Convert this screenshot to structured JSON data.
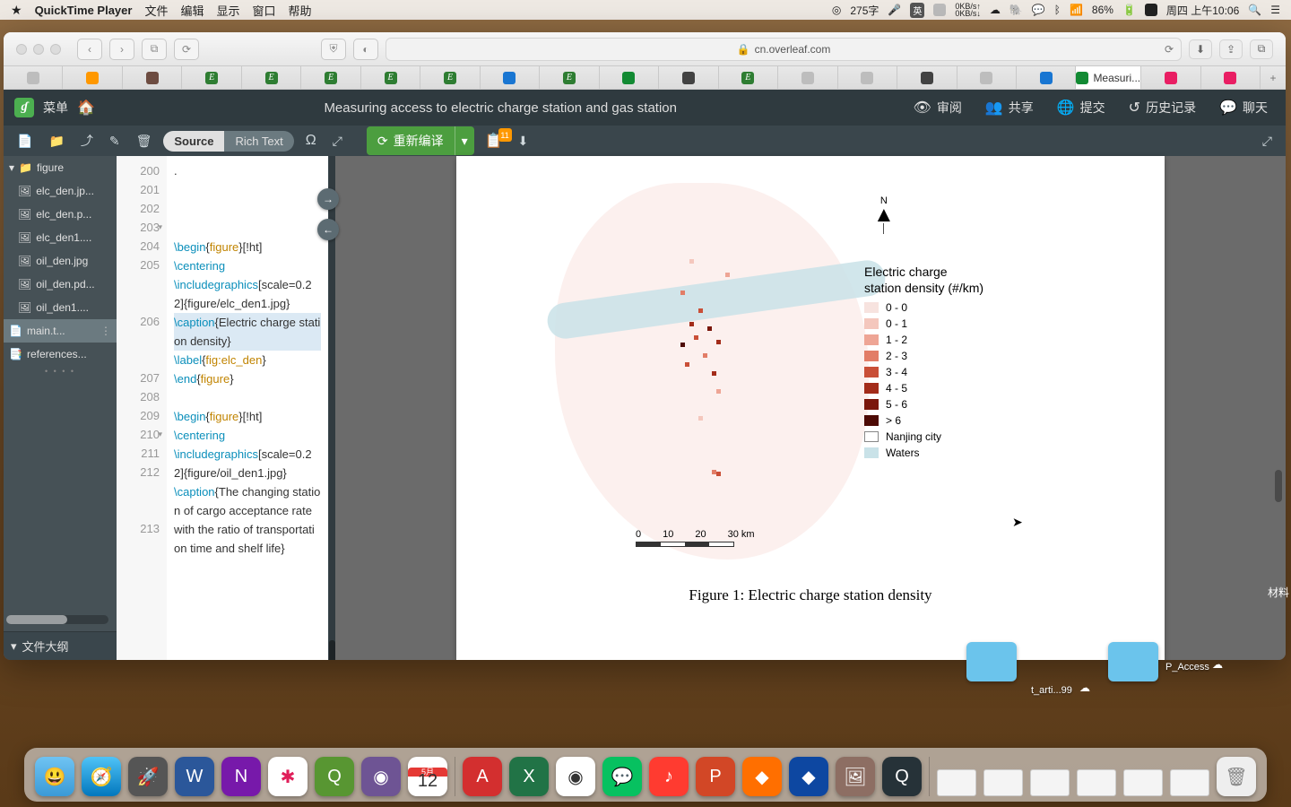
{
  "menubar": {
    "app_name": "QuickTime Player",
    "items": [
      "文件",
      "编辑",
      "显示",
      "窗口",
      "帮助"
    ],
    "right": {
      "zoom": "275字",
      "net_up": "0KB/s",
      "net_dn": "0KB/s",
      "battery": "86%",
      "clock": "周四 上午10:06"
    }
  },
  "safari": {
    "url": "cn.overleaf.com",
    "active_tab_label": "Measuri...",
    "new_tab_plus": "+"
  },
  "overleaf_top": {
    "menu_label": "菜单",
    "project_title": "Measuring access to electric charge station and gas station",
    "review": "审阅",
    "share": "共享",
    "submit": "提交",
    "history": "历史记录",
    "chat": "聊天"
  },
  "toolbar": {
    "mode_source": "Source",
    "mode_rich": "Rich Text",
    "symbol": "Ω",
    "compile": "重新编译",
    "log_badge": "11"
  },
  "files": {
    "folder": "figure",
    "items": [
      "elc_den.jp...",
      "elc_den.p...",
      "elc_den1....",
      "oil_den.jpg",
      "oil_den.pd...",
      "oil_den1...."
    ],
    "main": "main.t...",
    "refs": "references...",
    "outline_label": "文件大纲"
  },
  "code": {
    "lines": [
      {
        "n": "200",
        "t": ""
      },
      {
        "n": "201",
        "t": ""
      },
      {
        "n": "202",
        "t": ""
      },
      {
        "n": "203",
        "seg": [
          {
            "c": "kw",
            "t": "\\begin"
          },
          {
            "c": "nm",
            "t": "{"
          },
          {
            "c": "arg",
            "t": "figure"
          },
          {
            "c": "nm",
            "t": "}[!ht]"
          }
        ]
      },
      {
        "n": "204",
        "seg": [
          {
            "c": "kw",
            "t": "\\centering"
          }
        ]
      },
      {
        "n": "205",
        "seg": [
          {
            "c": "kw",
            "t": "\\includegraphics"
          },
          {
            "c": "nm",
            "t": "[scale=0.22]{figure/elc_den1.jpg}"
          }
        ]
      },
      {
        "n": "206",
        "hl": true,
        "seg": [
          {
            "c": "kw",
            "t": "\\caption"
          },
          {
            "c": "nm",
            "t": "{Electric charge station density}"
          }
        ]
      },
      {
        "n": "207",
        "seg": [
          {
            "c": "kw",
            "t": "\\label"
          },
          {
            "c": "nm",
            "t": "{"
          },
          {
            "c": "arg",
            "t": "fig:elc_den"
          },
          {
            "c": "nm",
            "t": "}"
          }
        ]
      },
      {
        "n": "208",
        "seg": [
          {
            "c": "kw",
            "t": "\\end"
          },
          {
            "c": "nm",
            "t": "{"
          },
          {
            "c": "arg",
            "t": "figure"
          },
          {
            "c": "nm",
            "t": "}"
          }
        ]
      },
      {
        "n": "209",
        "t": ""
      },
      {
        "n": "210",
        "seg": [
          {
            "c": "kw",
            "t": "\\begin"
          },
          {
            "c": "nm",
            "t": "{"
          },
          {
            "c": "arg",
            "t": "figure"
          },
          {
            "c": "nm",
            "t": "}[!ht]"
          }
        ]
      },
      {
        "n": "211",
        "seg": [
          {
            "c": "kw",
            "t": "\\centering"
          }
        ]
      },
      {
        "n": "212",
        "seg": [
          {
            "c": "kw",
            "t": "\\includegraphics"
          },
          {
            "c": "nm",
            "t": "[scale=0.22]{figure/oil_den1.jpg}"
          }
        ]
      },
      {
        "n": "213",
        "seg": [
          {
            "c": "kw",
            "t": "\\caption"
          },
          {
            "c": "nm",
            "t": "{The changing station of cargo acceptance rate with the ratio of transportation time and shelf life}"
          }
        ]
      }
    ],
    "first_dot": "."
  },
  "pdf": {
    "compass_n": "N",
    "legend_title_l1": "Electric charge",
    "legend_title_l2": "station density (#/km)",
    "legend_items": [
      {
        "color": "#f7e3df",
        "label": "0 - 0"
      },
      {
        "color": "#f4c7bd",
        "label": "0 - 1"
      },
      {
        "color": "#eea595",
        "label": "1 - 2"
      },
      {
        "color": "#e27d67",
        "label": "2 - 3"
      },
      {
        "color": "#c94f37",
        "label": "3 - 4"
      },
      {
        "color": "#a32c1a",
        "label": "4 - 5"
      },
      {
        "color": "#7a170c",
        "label": "5 - 6"
      },
      {
        "color": "#4d0a05",
        "label": "> 6"
      }
    ],
    "legend_extra": [
      {
        "color": "#ffffff",
        "border": "#888",
        "label": "Nanjing city"
      },
      {
        "color": "#c9e2e8",
        "label": "Waters"
      }
    ],
    "scale_labels": [
      "0",
      "10",
      "20",
      "30 km"
    ],
    "caption": "Figure 1: Electric charge station density"
  },
  "desktop": {
    "folder_a": "t_arti...99",
    "folder_b": "P_Access",
    "material": "材料"
  },
  "chart_data": {
    "type": "map-choropleth",
    "title": "Electric charge station density",
    "unit": "#/km",
    "region": "Nanjing city",
    "scale_km": [
      0,
      10,
      20,
      30
    ],
    "breaks": [
      "0 - 0",
      "0 - 1",
      "1 - 2",
      "2 - 3",
      "3 - 4",
      "4 - 5",
      "5 - 6",
      "> 6"
    ],
    "colors": [
      "#f7e3df",
      "#f4c7bd",
      "#eea595",
      "#e27d67",
      "#c94f37",
      "#a32c1a",
      "#7a170c",
      "#4d0a05"
    ],
    "layers": [
      "Nanjing city",
      "Waters"
    ]
  }
}
